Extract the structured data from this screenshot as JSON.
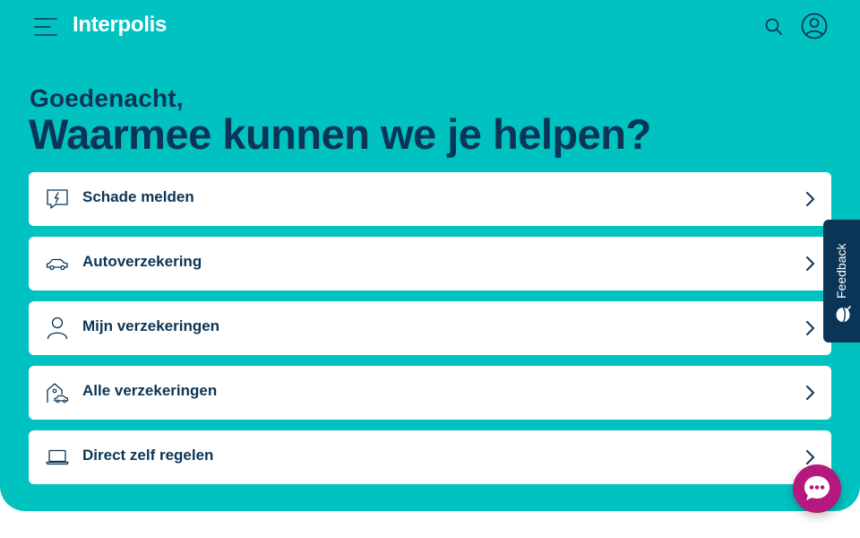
{
  "header": {
    "logo_text": "Interpolis",
    "menu_icon": "hamburger-menu-icon",
    "search_icon": "search-icon",
    "account_icon": "user-account-icon"
  },
  "hero": {
    "greeting": "Goedenacht,",
    "headline": "Waarmee kunnen we je helpen?"
  },
  "menu": {
    "items": [
      {
        "label": "Schade melden",
        "icon": "damage-report-icon"
      },
      {
        "label": "Autoverzekering",
        "icon": "car-icon"
      },
      {
        "label": "Mijn verzekeringen",
        "icon": "person-icon"
      },
      {
        "label": "Alle verzekeringen",
        "icon": "house-car-icon"
      },
      {
        "label": "Direct zelf regelen",
        "icon": "laptop-icon"
      }
    ]
  },
  "feedback": {
    "label": "Feedback"
  },
  "chat": {
    "icon": "chat-bubble-icon"
  },
  "colors": {
    "brand_teal": "#00c2c0",
    "navy": "#0b3556",
    "chat_magenta": "#b5197d",
    "card_background": "#ffffff"
  }
}
